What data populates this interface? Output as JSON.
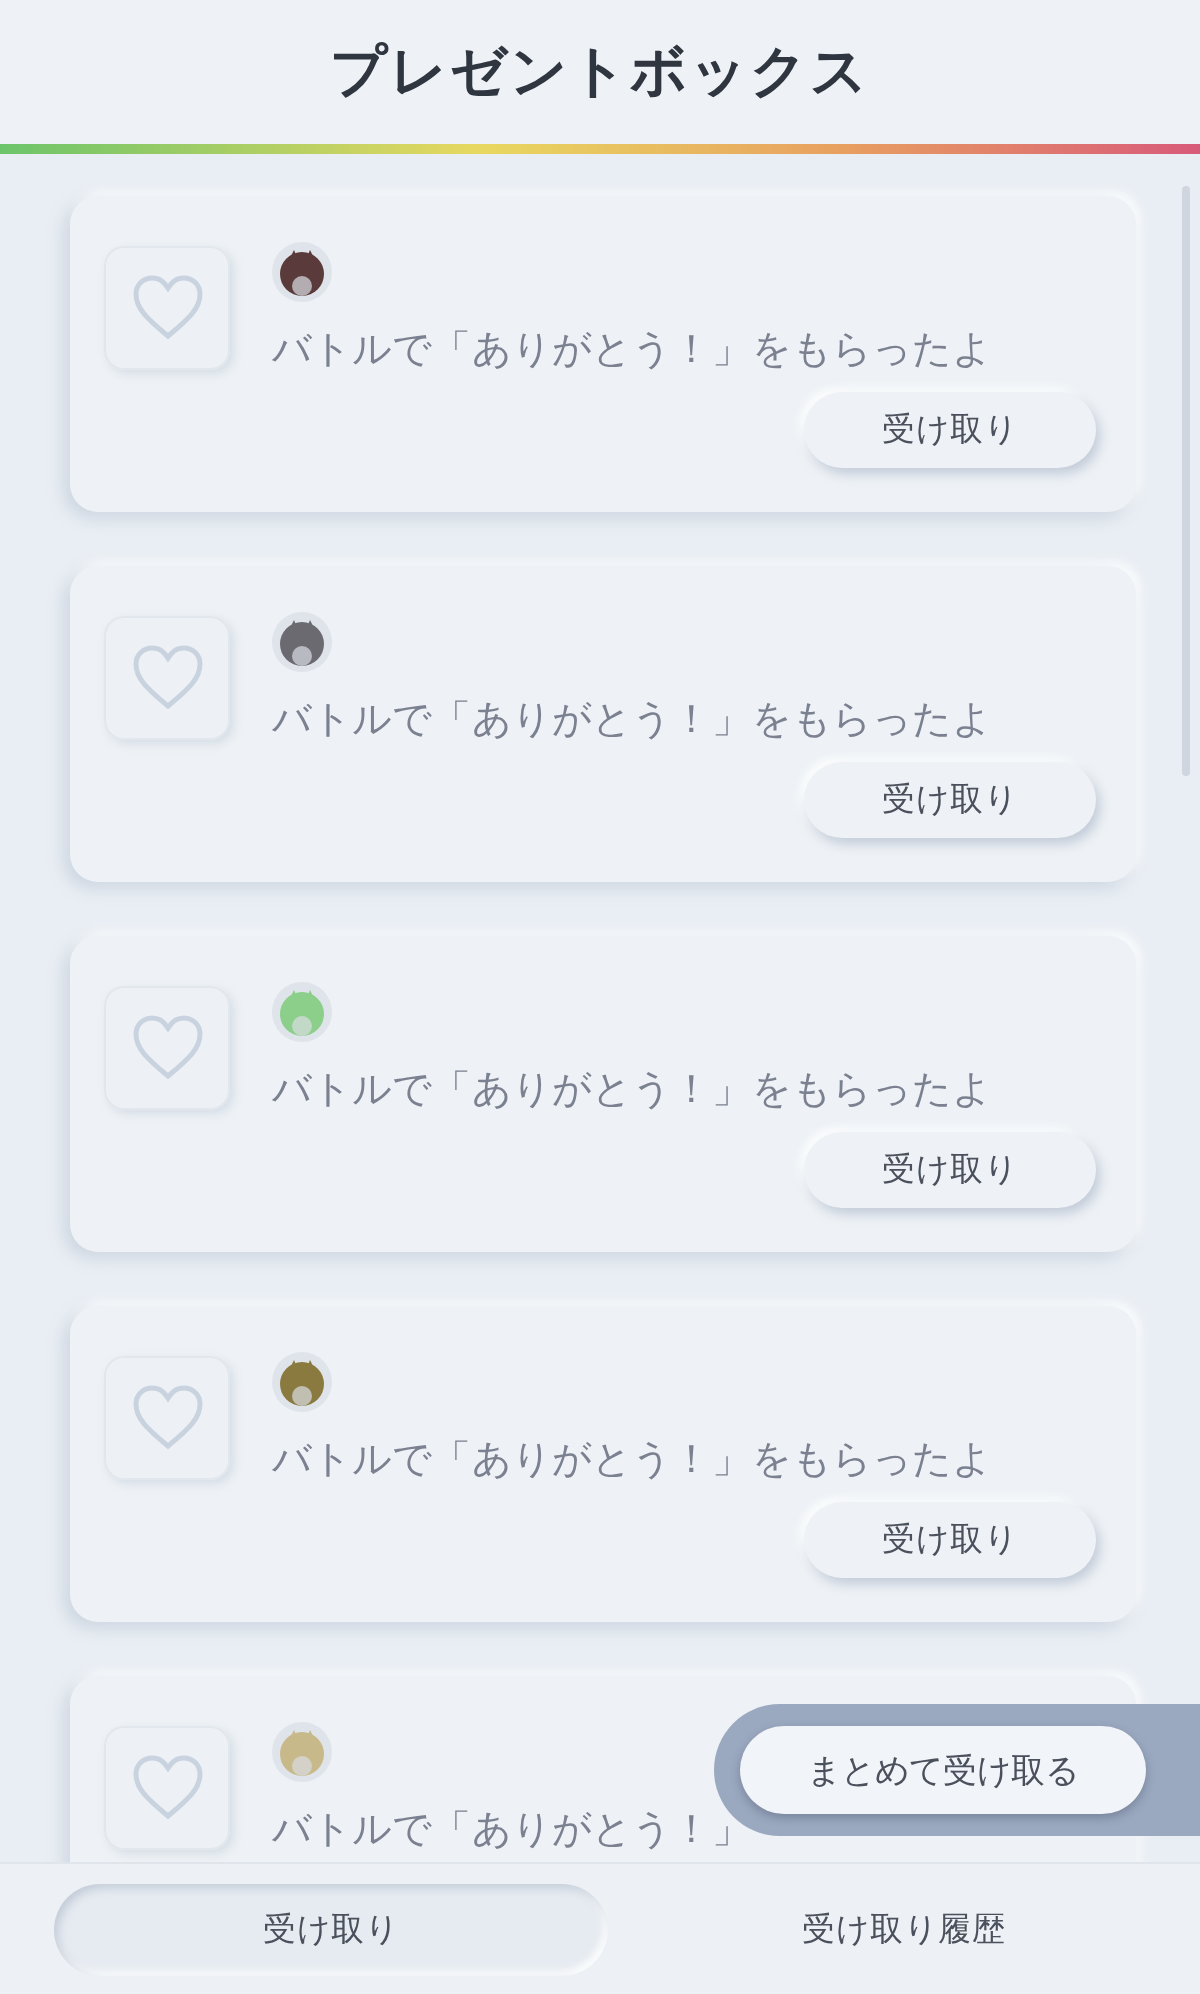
{
  "header": {
    "title": "プレゼントボックス"
  },
  "gifts": [
    {
      "message": "バトルで「ありがとう！」をもらったよ",
      "button": "受け取り"
    },
    {
      "message": "バトルで「ありがとう！」をもらったよ",
      "button": "受け取り"
    },
    {
      "message": "バトルで「ありがとう！」をもらったよ",
      "button": "受け取り"
    },
    {
      "message": "バトルで「ありがとう！」をもらったよ",
      "button": "受け取り"
    },
    {
      "message": "バトルで「ありがとう！」"
    }
  ],
  "claim_all_button": "まとめて受け取る",
  "tabs": [
    {
      "label": "受け取り",
      "selected": true
    },
    {
      "label": "受け取り履歴",
      "selected": false
    }
  ]
}
